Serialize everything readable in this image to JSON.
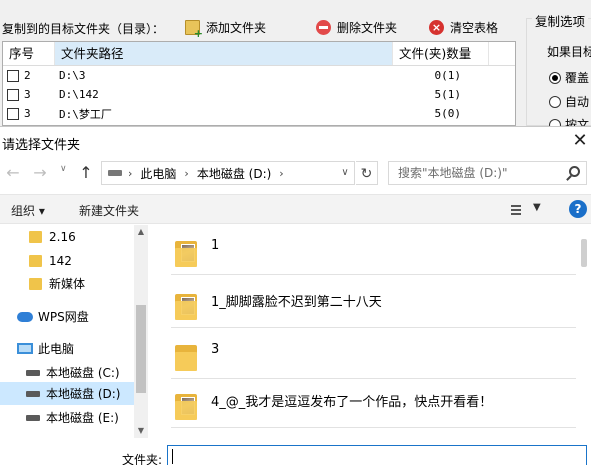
{
  "background_app": {
    "target_label": "复制到的目标文件夹（目录）：",
    "toolbar": {
      "add_folder": "添加文件夹",
      "delete_folder": "删除文件夹",
      "clear_table": "清空表格"
    },
    "table": {
      "headers": {
        "seq": "序号",
        "path": "文件夹路径",
        "count": "文件(夹)数量"
      },
      "rows": [
        {
          "seq": "2",
          "path": "D:\\3",
          "count": "0(1)"
        },
        {
          "seq": "3",
          "path": "D:\\142",
          "count": "5(1)"
        },
        {
          "seq": "3",
          "path": "D:\\梦工厂",
          "count": "5(0)"
        }
      ]
    },
    "copy_options": {
      "title": "复制选项",
      "subtitle": "如果目标",
      "radio_overwrite": "覆盖",
      "radio_auto": "自动",
      "radio_third": "按文"
    }
  },
  "dialog": {
    "title": "请选择文件夹",
    "close": "✕",
    "nav": {
      "back": "←",
      "forward": "→",
      "dropdown": "∨",
      "up": "↑"
    },
    "address": {
      "crumbs": [
        "此电脑",
        "本地磁盘 (D:)"
      ],
      "separator": "›",
      "dropdown": "∨",
      "refresh": "↻"
    },
    "search": {
      "placeholder": "搜索\"本地磁盘 (D:)\""
    },
    "commands": {
      "organize": "组织 ▾",
      "new_folder": "新建文件夹",
      "view_dd": "▼",
      "help": "?"
    },
    "tree": [
      {
        "label": "2.16"
      },
      {
        "label": "142"
      },
      {
        "label": "新媒体"
      },
      {
        "label": "WPS网盘"
      },
      {
        "label": "此电脑"
      },
      {
        "label": "本地磁盘 (C:)"
      },
      {
        "label": "本地磁盘 (D:)"
      },
      {
        "label": "本地磁盘 (E:)"
      }
    ],
    "files": [
      {
        "name": "1"
      },
      {
        "name": "1_脚脚露脸不迟到第二十八天"
      },
      {
        "name": "3"
      },
      {
        "name": "4_@_我才是逗逗发布了一个作品，快点开看看！"
      }
    ],
    "filename_label": "文件夹:",
    "filename_value": ""
  }
}
